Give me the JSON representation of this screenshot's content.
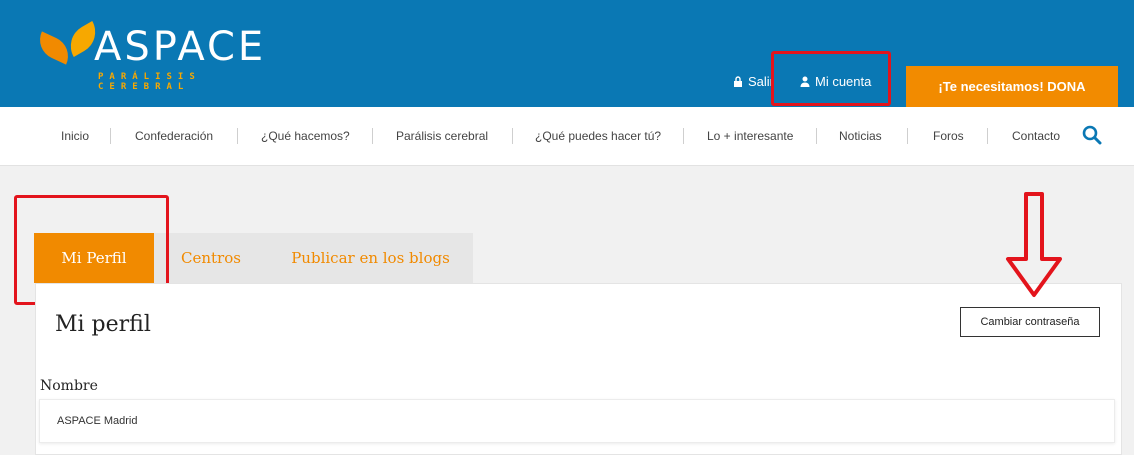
{
  "header": {
    "logo": {
      "name": "ASPACE",
      "tagline": "PARÁLISIS CEREBRAL"
    },
    "utility": {
      "logout": "Salir",
      "account": "Mi cuenta"
    },
    "donate": "¡Te necesitamos! DONA"
  },
  "nav": {
    "items": [
      "Inicio",
      "Confederación",
      "¿Qué hacemos?",
      "Parálisis cerebral",
      "¿Qué puedes hacer tú?",
      "Lo + interesante",
      "Noticias",
      "Foros",
      "Contacto"
    ]
  },
  "tabs": [
    "Mi Perfil",
    "Centros",
    "Publicar en los blogs"
  ],
  "profile": {
    "title": "Mi perfil",
    "change_password": "Cambiar contraseña",
    "name_label": "Nombre",
    "name_value": "ASPACE Madrid"
  },
  "colors": {
    "brand_blue": "#0a78b4",
    "accent_orange": "#f18a00",
    "highlight_red": "#e3141c"
  }
}
